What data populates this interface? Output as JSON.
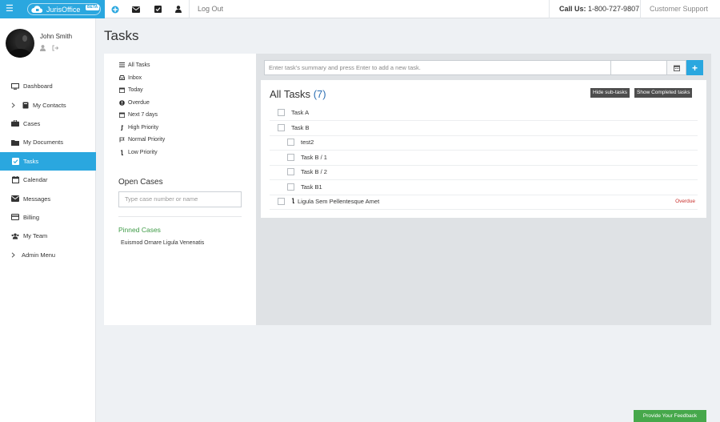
{
  "app": {
    "name": "JurisOffice",
    "beta": "BETA"
  },
  "topbar": {
    "logout": "Log Out",
    "call_label": "Call Us:",
    "call_number": "1-800-727-9807",
    "support": "Customer Support",
    "icons": [
      "plus-circle-icon",
      "envelope-icon",
      "check-square-icon",
      "user-icon"
    ]
  },
  "user": {
    "name": "John Smith"
  },
  "sidebar": {
    "items": [
      {
        "label": "Dashboard",
        "icon": "monitor-icon"
      },
      {
        "label": "My Contacts",
        "icon": "book-icon"
      },
      {
        "label": "Cases",
        "icon": "briefcase-icon"
      },
      {
        "label": "My Documents",
        "icon": "folder-icon"
      },
      {
        "label": "Tasks",
        "icon": "check-square-icon",
        "active": true
      },
      {
        "label": "Calendar",
        "icon": "calendar-icon"
      },
      {
        "label": "Messages",
        "icon": "envelope-icon"
      },
      {
        "label": "Billing",
        "icon": "credit-card-icon"
      },
      {
        "label": "My Team",
        "icon": "users-icon"
      },
      {
        "label": "Admin Menu",
        "icon": "chevron-right-icon"
      }
    ]
  },
  "page": {
    "title": "Tasks"
  },
  "filters": {
    "items": [
      {
        "label": "All Tasks",
        "icon": "list-icon"
      },
      {
        "label": "Inbox",
        "icon": "inbox-icon"
      },
      {
        "label": "Today",
        "icon": "calendar-icon"
      },
      {
        "label": "Overdue",
        "icon": "exclamation-circle-icon"
      },
      {
        "label": "Next 7 days",
        "icon": "calendar-icon"
      },
      {
        "label": "High Priority",
        "icon": "high-priority-icon"
      },
      {
        "label": "Normal Priority",
        "icon": "flag-icon"
      },
      {
        "label": "Low Priority",
        "icon": "low-priority-icon"
      }
    ],
    "open_cases_title": "Open Cases",
    "case_search_placeholder": "Type case number or name",
    "pinned_title": "Pinned Cases",
    "pinned_items": [
      "Euismod Ornare Ligula Venenatis"
    ]
  },
  "tasks": {
    "new_task_placeholder": "Enter task's summary and press Enter to add a new task.",
    "add_label": "+",
    "heading": "All Tasks",
    "count": "(7)",
    "hide_subtasks": "Hide sub-tasks",
    "show_completed": "Show Completed tasks",
    "rows": [
      {
        "label": "Task A",
        "level": 0,
        "flag": "",
        "status": ""
      },
      {
        "label": "Task B",
        "level": 0,
        "flag": "",
        "status": ""
      },
      {
        "label": "test2",
        "level": 1,
        "flag": "",
        "status": ""
      },
      {
        "label": "Task B / 1",
        "level": 1,
        "flag": "",
        "status": ""
      },
      {
        "label": "Task B / 2",
        "level": 1,
        "flag": "",
        "status": ""
      },
      {
        "label": "Task B1",
        "level": 1,
        "flag": "",
        "status": ""
      },
      {
        "label": "Ligula Sem Pellentesque Amet",
        "level": 0,
        "flag": "low-priority-icon",
        "status": "Overdue"
      }
    ]
  },
  "feedback": {
    "label": "Provide Your Feedback"
  },
  "colors": {
    "accent": "#2aa7df",
    "overdue": "#c9302c",
    "pinned": "#3f9b47",
    "feedback": "#46a84b"
  }
}
